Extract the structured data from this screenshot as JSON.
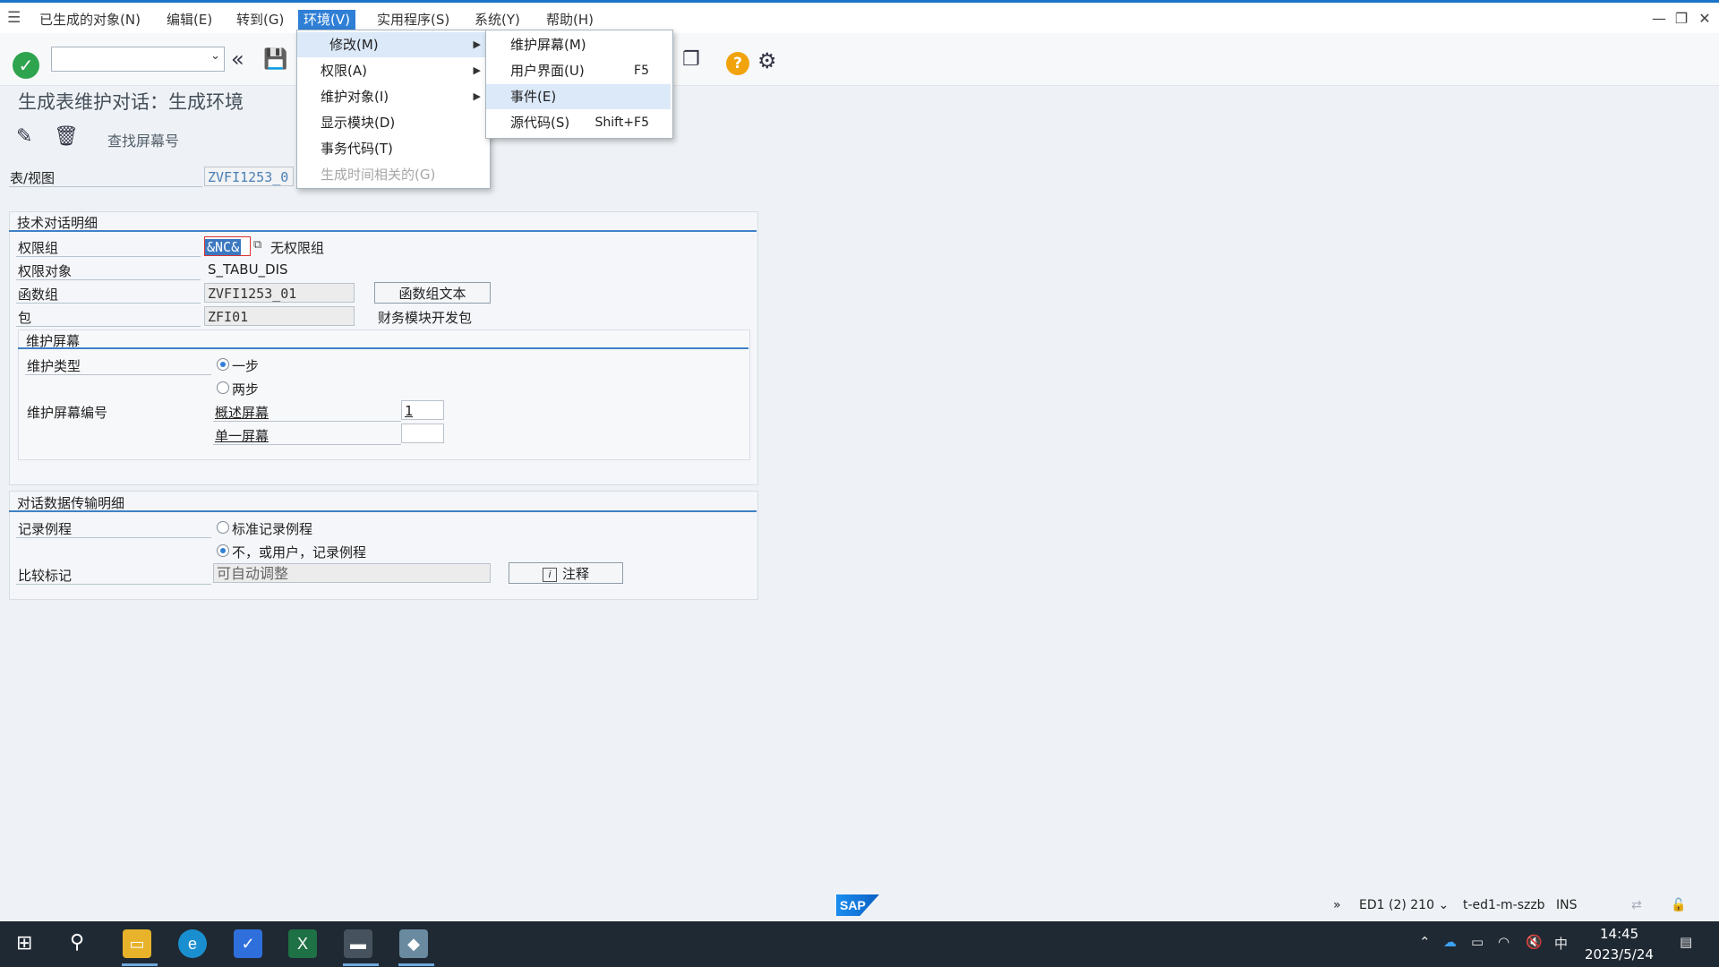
{
  "menubar": {
    "items": [
      {
        "label": "已生成的对象(N)"
      },
      {
        "label": "编辑(E)"
      },
      {
        "label": "转到(G)"
      },
      {
        "label": "环境(V)"
      },
      {
        "label": "实用程序(S)"
      },
      {
        "label": "系统(Y)"
      },
      {
        "label": "帮助(H)"
      }
    ]
  },
  "toolbar": {
    "command_field_value": ""
  },
  "page": {
    "title": "生成表维护对话：生成环境",
    "find_screen_label": "查找屏幕号"
  },
  "form": {
    "table_view_label": "表/视图",
    "table_view_value": "ZVFI1253_0",
    "tech_section_title": "技术对话明细",
    "auth_group_label": "权限组",
    "auth_group_value": "&NC&",
    "auth_group_text": "无权限组",
    "auth_object_label": "权限对象",
    "auth_object_value": "S_TABU_DIS",
    "function_group_label": "函数组",
    "function_group_value": "ZVFI1253_01",
    "function_group_text_button": "函数组文本",
    "package_label": "包",
    "package_value": "ZFI01",
    "package_text": "财务模块开发包",
    "maint_screen_title": "维护屏幕",
    "maint_type_label": "维护类型",
    "maint_type_option1": "一步",
    "maint_type_option2": "两步",
    "maint_screen_no_label": "维护屏幕编号",
    "overview_screen_label": "概述屏幕",
    "overview_screen_value": "1",
    "single_screen_label": "单一屏幕",
    "single_screen_value": "",
    "transport_section_title": "对话数据传输明细",
    "record_routine_label": "记录例程",
    "record_option1": "标准记录例程",
    "record_option2": "不，或用户，记录例程",
    "compare_flag_label": "比较标记",
    "compare_flag_value": "可自动调整",
    "note_button": "注释"
  },
  "env_menu": {
    "items": [
      {
        "label": "修改(M)"
      },
      {
        "label": "权限(A)"
      },
      {
        "label": "维护对象(I)"
      },
      {
        "label": "显示模块(D)"
      },
      {
        "label": "事务代码(T)"
      },
      {
        "label": "生成时间相关的(G)"
      }
    ]
  },
  "modify_submenu": {
    "items": [
      {
        "label": "维护屏幕(M)",
        "accel": ""
      },
      {
        "label": "用户界面(U)",
        "accel": "F5"
      },
      {
        "label": "事件(E)",
        "accel": ""
      },
      {
        "label": "源代码(S)",
        "accel": "Shift+F5"
      }
    ]
  },
  "statusbar": {
    "logo_text": "SAP",
    "system": "ED1 (2) 210",
    "host": "t-ed1-m-szzb",
    "mode": "INS"
  },
  "taskbar": {
    "time": "14:45",
    "date": "2023/5/24",
    "ime": "中"
  },
  "colors": {
    "accent": "#2f7fd6",
    "ok_green": "#2ea44f",
    "help_orange": "#f0a30a"
  }
}
